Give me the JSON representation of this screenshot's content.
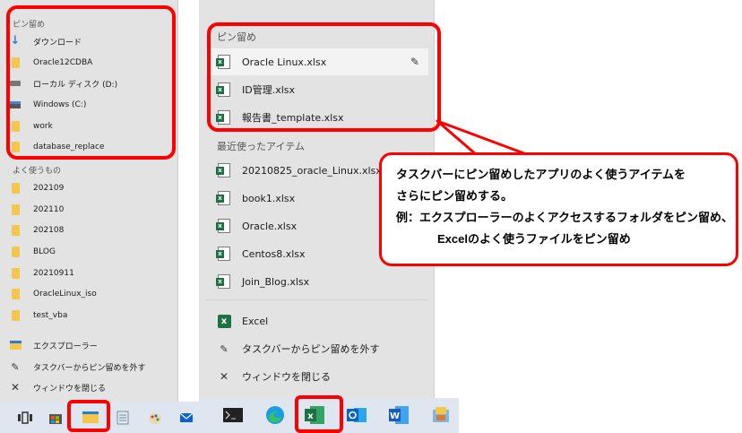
{
  "left_menu": {
    "pinned_header": "ピン留め",
    "pinned_items": [
      {
        "label": "ダウンロード",
        "icon": "download-icon"
      },
      {
        "label": "Oracle12CDBA",
        "icon": "folder-icon"
      },
      {
        "label": "ローカル ディスク (D:)",
        "icon": "drive-icon"
      },
      {
        "label": "Windows (C:)",
        "icon": "windows-drive-icon"
      },
      {
        "label": "work",
        "icon": "folder-icon"
      },
      {
        "label": "database_replace",
        "icon": "folder-icon"
      }
    ],
    "frequent_header": "よく使うもの",
    "frequent_items": [
      "202109",
      "202110",
      "202108",
      "BLOG",
      "20210911",
      "OracleLinux_iso",
      "test_vba"
    ],
    "actions": [
      {
        "label": "エクスプローラー",
        "icon": "explorer-icon"
      },
      {
        "label": "タスクバーからピン留めを外す",
        "icon": "unpin-icon"
      },
      {
        "label": "ウィンドウを閉じる",
        "icon": "close-icon"
      }
    ]
  },
  "right_menu": {
    "pinned_header": "ピン留め",
    "pinned_items": [
      "Oracle Linux.xlsx",
      "ID管理.xlsx",
      "報告書_template.xlsx"
    ],
    "recent_header": "最近使ったアイテム",
    "recent_items": [
      "20210825_oracle_Linux.xlsx",
      "book1.xlsx",
      "Oracle.xlsx",
      "Centos8.xlsx",
      "Join_Blog.xlsx"
    ],
    "actions": [
      {
        "label": "Excel",
        "icon": "excel-icon"
      },
      {
        "label": "タスクバーからピン留めを外す",
        "icon": "unpin-icon"
      },
      {
        "label": "ウィンドウを閉じる",
        "icon": "close-icon"
      }
    ]
  },
  "callout": {
    "line1": "タスクバーにピン留めしたアプリのよく使うアイテムを",
    "line2": "さらにピン留めする。",
    "line3": "例：エクスプローラーのよくアクセスするフォルダをピン留め、",
    "line4": "Excelのよく使うファイルをピン留め"
  },
  "taskbar_left": [
    "task-view-icon",
    "store-icon",
    "explorer-icon",
    "notepad-icon",
    "paint-icon",
    "mail-icon"
  ],
  "taskbar_right": [
    "terminal-icon",
    "edge-icon",
    "excel-icon",
    "outlook-icon",
    "word-icon",
    "app-icon"
  ],
  "colors": {
    "annotation_red": "#ff0000",
    "excel_green": "#1e7145",
    "menu_bg": "#e3e3e3"
  }
}
